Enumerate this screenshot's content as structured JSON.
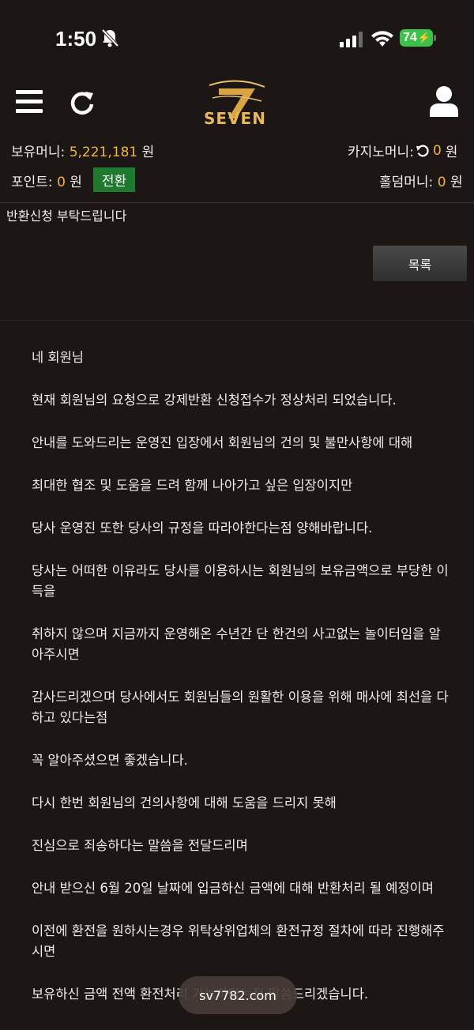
{
  "status_bar": {
    "time": "1:50",
    "battery": "74"
  },
  "header": {
    "logo_text": "SEVEN",
    "logo_number": "7"
  },
  "account": {
    "holding_money_label": "보유머니:",
    "holding_money_value": "5,221,181",
    "holding_money_unit": "원",
    "casino_money_label": "카지노머니:",
    "casino_money_value": "0",
    "casino_money_unit": "원",
    "points_label": "포인트:",
    "points_value": "0",
    "points_unit": "원",
    "convert_button": "전환",
    "holdem_money_label": "홀덤머니:",
    "holdem_money_value": "0",
    "holdem_money_unit": "원"
  },
  "post": {
    "title": "반환신청 부탁드립니다",
    "list_button": "목록"
  },
  "reply": {
    "paragraphs": [
      "네 회원님",
      "현재 회원님의 요청으로 강제반환 신청접수가 정상처리 되었습니다.",
      "안내를 도와드리는 운영진 입장에서 회원님의 건의 및 불만사항에 대해",
      "최대한 협조 및 도움을 드려 함께 나아가고 싶은 입장이지만",
      "당사 운영진 또한 당사의 규정을 따라야한다는점 양해바랍니다.",
      "당사는 어떠한 이유라도 당사를 이용하시는 회원님의 보유금액으로 부당한 이득을",
      "취하지 않으며 지금까지 운영해온 수년간 단 한건의 사고없는 놀이터임을 알아주시면",
      "감사드리겠으며 당사에서도 회원님들의 원활한 이용을 위해 매사에 최선을 다하고 있다는점",
      "꼭 알아주셨으면 좋겠습니다.",
      "다시 한번 회원님의 건의사항에 대해 도움을 드리지 못해",
      "진심으로 죄송하다는 말씀을 전달드리며",
      "안내 받으신 6월 20일 날짜에 입금하신 금액에 대해 반환처리 될 예정이며",
      "이전에 환전을 원하시는경우 위탁상위업체의 환전규정 절차에 따라 진행해주시면",
      "보유하신 금액 전액 환전처리 가능하다는점 말씀드리겠습니다."
    ]
  },
  "toast": {
    "text": "sv7782.com"
  },
  "colors": {
    "background": "#1c1614",
    "accent_value": "#f0b53a",
    "convert_button": "#1e7a2e",
    "battery": "#3cc24a"
  }
}
